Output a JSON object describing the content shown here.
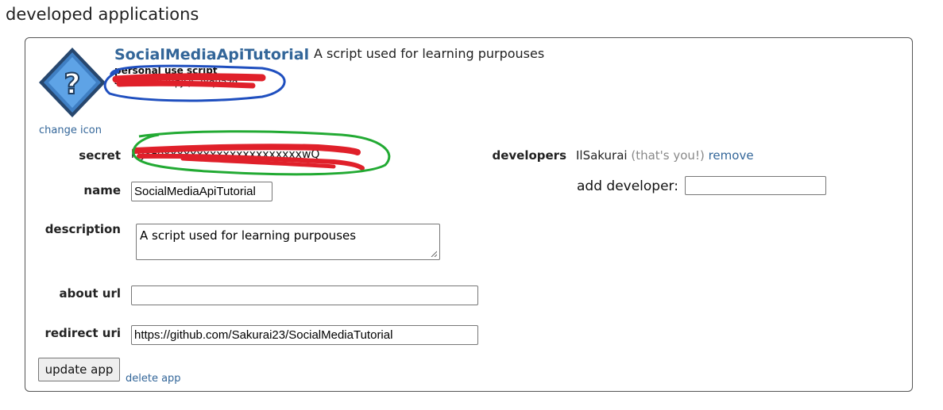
{
  "page": {
    "title": "developed applications"
  },
  "app": {
    "name": "SocialMediaApiTutorial",
    "description": "A script used for learning purpouses",
    "type_label": "personal use script",
    "client_id": "4EuhXxxx3RpJQS2xquazg",
    "change_icon": "change icon"
  },
  "form": {
    "secret_label": "secret",
    "secret_value": "kgxFoxxxxxxxxxxxxxxxxxxxxxwQ",
    "name_label": "name",
    "name_value": "SocialMediaApiTutorial",
    "description_label": "description",
    "description_value": "A script used for learning purpouses",
    "about_url_label": "about url",
    "about_url_value": "",
    "redirect_uri_label": "redirect uri",
    "redirect_uri_value": "https://github.com/Sakurai23/SocialMediaTutorial",
    "update_button": "update app",
    "delete_link": "delete app"
  },
  "developers": {
    "label": "developers",
    "name": "IlSakurai",
    "you_note": "(that's you!)",
    "remove": "remove",
    "add_label": "add developer:",
    "add_value": ""
  },
  "colors": {
    "link": "#336699",
    "redaction_red": "#e0202a",
    "circle_blue": "#1f4fbf",
    "circle_green": "#22aa33"
  },
  "icons": {
    "app_icon": "question-diamond-icon",
    "resize_grip": "resize-grip-icon"
  }
}
